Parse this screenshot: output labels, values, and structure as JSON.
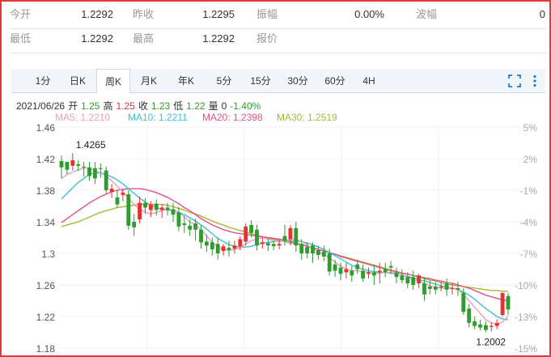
{
  "quote": {
    "rows": [
      [
        {
          "label": "今开",
          "value": "1.2292"
        },
        {
          "label": "昨收",
          "value": "1.2295"
        },
        {
          "label": "振幅",
          "value": "0.00%"
        },
        {
          "label": "波幅",
          "value": "0"
        }
      ],
      [
        {
          "label": "最低",
          "value": "1.2292"
        },
        {
          "label": "最高",
          "value": "1.2292"
        },
        {
          "label": "报价",
          "value": ""
        },
        {
          "label": "",
          "value": ""
        }
      ]
    ]
  },
  "tabs": [
    "1分",
    "日K",
    "周K",
    "月K",
    "年K",
    "5分",
    "15分",
    "30分",
    "60分",
    "4H"
  ],
  "active_tab": "周K",
  "toolbar_icons": [
    "fullscreen-icon",
    "more-vertical-icon"
  ],
  "info": {
    "date": "2021/06/26",
    "open_label": "开",
    "open": "1.25",
    "high_label": "高",
    "high": "1.25",
    "close_label": "收",
    "close": "1.23",
    "low_label": "低",
    "low": "1.22",
    "vol_label": "量",
    "vol": "0",
    "change": "-1.40%"
  },
  "ma_legend": [
    {
      "text": "MA5: 1.2210",
      "color": "#e8a0c0"
    },
    {
      "text": "MA10: 1.2211",
      "color": "#3cc0d0"
    },
    {
      "text": "MA20: 1.2398",
      "color": "#e0508c"
    },
    {
      "text": "MA30: 1.2519",
      "color": "#a8b830"
    }
  ],
  "colors": {
    "up": "#e8312f",
    "down": "#2e9c2e",
    "border": "#e03a3a"
  },
  "chart_data": {
    "type": "candlestick",
    "ylim": [
      1.18,
      1.46
    ],
    "y_ticks": [
      "1.46",
      "1.42",
      "1.38",
      "1.34",
      "1.3",
      "1.26",
      "1.22",
      "1.18"
    ],
    "pct_ticks": [
      "5%",
      "2%",
      "-1%",
      "-4%",
      "-7%",
      "-10%",
      "-13%",
      "-15%"
    ],
    "max_label": "1.4265",
    "min_label": "1.2002",
    "candles": [
      [
        1.417,
        1.424,
        1.409,
        1.395,
        "d"
      ],
      [
        1.406,
        1.413,
        1.416,
        1.4,
        "d"
      ],
      [
        1.411,
        1.427,
        1.418,
        1.405,
        "u"
      ],
      [
        1.413,
        1.418,
        1.411,
        1.404,
        "d"
      ],
      [
        1.409,
        1.416,
        1.41,
        1.397,
        "d"
      ],
      [
        1.409,
        1.416,
        1.398,
        1.392,
        "d"
      ],
      [
        1.408,
        1.416,
        1.395,
        1.388,
        "d"
      ],
      [
        1.408,
        1.414,
        1.407,
        1.396,
        "d"
      ],
      [
        1.405,
        1.41,
        1.38,
        1.375,
        "d"
      ],
      [
        1.378,
        1.388,
        1.382,
        1.37,
        "u"
      ],
      [
        1.371,
        1.38,
        1.362,
        1.358,
        "d"
      ],
      [
        1.374,
        1.382,
        1.377,
        1.366,
        "u"
      ],
      [
        1.375,
        1.38,
        1.335,
        1.33,
        "d"
      ],
      [
        1.34,
        1.35,
        1.333,
        1.322,
        "d"
      ],
      [
        1.343,
        1.372,
        1.364,
        1.338,
        "u"
      ],
      [
        1.364,
        1.37,
        1.358,
        1.35,
        "d"
      ],
      [
        1.355,
        1.366,
        1.362,
        1.346,
        "u"
      ],
      [
        1.363,
        1.368,
        1.355,
        1.348,
        "d"
      ],
      [
        1.355,
        1.362,
        1.358,
        1.345,
        "u"
      ],
      [
        1.358,
        1.364,
        1.355,
        1.348,
        "d"
      ],
      [
        1.356,
        1.364,
        1.349,
        1.34,
        "d"
      ],
      [
        1.352,
        1.359,
        1.334,
        1.328,
        "d"
      ],
      [
        1.338,
        1.348,
        1.336,
        1.326,
        "d"
      ],
      [
        1.335,
        1.343,
        1.33,
        1.322,
        "d"
      ],
      [
        1.338,
        1.344,
        1.33,
        1.316,
        "d"
      ],
      [
        1.33,
        1.336,
        1.314,
        1.306,
        "d"
      ],
      [
        1.315,
        1.324,
        1.31,
        1.302,
        "d"
      ],
      [
        1.314,
        1.32,
        1.305,
        1.297,
        "d"
      ],
      [
        1.312,
        1.32,
        1.3,
        1.292,
        "d"
      ],
      [
        1.303,
        1.312,
        1.309,
        1.297,
        "u"
      ],
      [
        1.307,
        1.316,
        1.304,
        1.296,
        "d"
      ],
      [
        1.306,
        1.316,
        1.31,
        1.3,
        "u"
      ],
      [
        1.309,
        1.322,
        1.318,
        1.304,
        "u"
      ],
      [
        1.315,
        1.338,
        1.334,
        1.31,
        "u"
      ],
      [
        1.336,
        1.342,
        1.326,
        1.32,
        "d"
      ],
      [
        1.33,
        1.336,
        1.31,
        1.304,
        "d"
      ],
      [
        1.312,
        1.32,
        1.314,
        1.306,
        "u"
      ],
      [
        1.313,
        1.318,
        1.31,
        1.303,
        "d"
      ],
      [
        1.312,
        1.316,
        1.309,
        1.304,
        "d"
      ],
      [
        1.31,
        1.318,
        1.312,
        1.305,
        "u"
      ],
      [
        1.322,
        1.336,
        1.316,
        1.31,
        "d"
      ],
      [
        1.318,
        1.336,
        1.332,
        1.31,
        "u"
      ],
      [
        1.332,
        1.34,
        1.31,
        1.302,
        "d"
      ],
      [
        1.312,
        1.318,
        1.3,
        1.292,
        "d"
      ],
      [
        1.308,
        1.314,
        1.3,
        1.294,
        "d"
      ],
      [
        1.31,
        1.314,
        1.3,
        1.288,
        "d"
      ],
      [
        1.304,
        1.31,
        1.298,
        1.292,
        "d"
      ],
      [
        1.302,
        1.31,
        1.296,
        1.29,
        "d"
      ],
      [
        1.3,
        1.306,
        1.277,
        1.272,
        "d"
      ],
      [
        1.286,
        1.292,
        1.278,
        1.27,
        "d"
      ],
      [
        1.282,
        1.288,
        1.274,
        1.266,
        "d"
      ],
      [
        1.28,
        1.288,
        1.276,
        1.268,
        "u"
      ],
      [
        1.278,
        1.284,
        1.272,
        1.264,
        "d"
      ],
      [
        1.286,
        1.292,
        1.28,
        1.274,
        "d"
      ],
      [
        1.278,
        1.286,
        1.268,
        1.264,
        "d"
      ],
      [
        1.274,
        1.282,
        1.276,
        1.268,
        "u"
      ],
      [
        1.276,
        1.286,
        1.272,
        1.26,
        "d"
      ],
      [
        1.278,
        1.288,
        1.276,
        1.262,
        "u"
      ],
      [
        1.28,
        1.288,
        1.276,
        1.27,
        "d"
      ],
      [
        1.284,
        1.29,
        1.282,
        1.274,
        "d"
      ],
      [
        1.276,
        1.282,
        1.27,
        1.262,
        "d"
      ],
      [
        1.272,
        1.28,
        1.266,
        1.262,
        "d"
      ],
      [
        1.27,
        1.276,
        1.262,
        1.256,
        "d"
      ],
      [
        1.27,
        1.278,
        1.26,
        1.254,
        "d"
      ],
      [
        1.262,
        1.274,
        1.272,
        1.256,
        "u"
      ],
      [
        1.262,
        1.27,
        1.248,
        1.24,
        "d"
      ],
      [
        1.258,
        1.266,
        1.255,
        1.248,
        "d"
      ],
      [
        1.258,
        1.264,
        1.254,
        1.248,
        "d"
      ],
      [
        1.258,
        1.264,
        1.258,
        1.252,
        "u"
      ],
      [
        1.262,
        1.268,
        1.254,
        1.246,
        "d"
      ],
      [
        1.256,
        1.262,
        1.256,
        1.248,
        "u"
      ],
      [
        1.256,
        1.264,
        1.254,
        1.246,
        "d"
      ],
      [
        1.25,
        1.256,
        1.226,
        1.222,
        "d"
      ],
      [
        1.23,
        1.236,
        1.212,
        1.206,
        "d"
      ],
      [
        1.214,
        1.22,
        1.208,
        1.204,
        "d"
      ],
      [
        1.21,
        1.216,
        1.206,
        1.202,
        "d"
      ],
      [
        1.209,
        1.214,
        1.203,
        1.2,
        "d"
      ],
      [
        1.207,
        1.212,
        1.208,
        1.201,
        "u"
      ],
      [
        1.208,
        1.216,
        1.212,
        1.204,
        "u"
      ],
      [
        1.222,
        1.25,
        1.25,
        1.22,
        "u"
      ],
      [
        1.246,
        1.25,
        1.229,
        1.222,
        "d"
      ]
    ],
    "ma5": [
      1.395,
      1.4,
      1.403,
      1.406,
      1.408,
      1.408,
      1.405,
      1.402,
      1.398,
      1.392,
      1.385,
      1.377,
      1.37,
      1.362,
      1.356,
      1.352,
      1.35,
      1.352,
      1.354,
      1.356,
      1.355,
      1.352,
      1.346,
      1.34,
      1.336,
      1.33,
      1.322,
      1.314,
      1.308,
      1.305,
      1.304,
      1.305,
      1.307,
      1.312,
      1.316,
      1.318,
      1.32,
      1.318,
      1.316,
      1.315,
      1.316,
      1.318,
      1.318,
      1.315,
      1.311,
      1.306,
      1.302,
      1.299,
      1.294,
      1.289,
      1.284,
      1.28,
      1.278,
      1.278,
      1.277,
      1.276,
      1.275,
      1.275,
      1.276,
      1.276,
      1.275,
      1.273,
      1.27,
      1.267,
      1.265,
      1.262,
      1.259,
      1.257,
      1.256,
      1.256,
      1.256,
      1.254,
      1.248,
      1.24,
      1.232,
      1.224,
      1.216,
      1.212,
      1.21,
      1.213,
      1.221
    ],
    "ma10": [
      1.369,
      1.376,
      1.383,
      1.39,
      1.395,
      1.4,
      1.402,
      1.402,
      1.4,
      1.397,
      1.393,
      1.388,
      1.382,
      1.376,
      1.37,
      1.365,
      1.361,
      1.358,
      1.356,
      1.355,
      1.354,
      1.352,
      1.349,
      1.345,
      1.341,
      1.336,
      1.331,
      1.325,
      1.319,
      1.315,
      1.311,
      1.309,
      1.308,
      1.308,
      1.309,
      1.311,
      1.313,
      1.314,
      1.315,
      1.316,
      1.316,
      1.316,
      1.316,
      1.315,
      1.313,
      1.311,
      1.308,
      1.305,
      1.301,
      1.297,
      1.293,
      1.289,
      1.285,
      1.282,
      1.28,
      1.278,
      1.277,
      1.276,
      1.276,
      1.275,
      1.274,
      1.273,
      1.271,
      1.269,
      1.267,
      1.265,
      1.263,
      1.261,
      1.259,
      1.257,
      1.256,
      1.254,
      1.251,
      1.247,
      1.242,
      1.236,
      1.23,
      1.225,
      1.22,
      1.217,
      1.216
    ],
    "ma20": [
      1.339,
      1.344,
      1.349,
      1.354,
      1.359,
      1.364,
      1.368,
      1.372,
      1.375,
      1.378,
      1.38,
      1.381,
      1.382,
      1.382,
      1.382,
      1.381,
      1.379,
      1.377,
      1.374,
      1.371,
      1.367,
      1.363,
      1.358,
      1.354,
      1.349,
      1.344,
      1.34,
      1.336,
      1.333,
      1.33,
      1.328,
      1.326,
      1.325,
      1.324,
      1.323,
      1.322,
      1.321,
      1.32,
      1.319,
      1.318,
      1.317,
      1.315,
      1.313,
      1.311,
      1.309,
      1.307,
      1.305,
      1.303,
      1.301,
      1.299,
      1.296,
      1.294,
      1.292,
      1.29,
      1.288,
      1.286,
      1.284,
      1.282,
      1.28,
      1.278,
      1.277,
      1.275,
      1.274,
      1.272,
      1.271,
      1.269,
      1.268,
      1.266,
      1.265,
      1.263,
      1.262,
      1.26,
      1.258,
      1.256,
      1.253,
      1.25,
      1.247,
      1.245,
      1.243,
      1.241,
      1.24
    ],
    "ma30": [
      1.334,
      1.336,
      1.338,
      1.34,
      1.343,
      1.346,
      1.349,
      1.352,
      1.354,
      1.356,
      1.358,
      1.359,
      1.36,
      1.361,
      1.362,
      1.362,
      1.362,
      1.362,
      1.362,
      1.361,
      1.359,
      1.357,
      1.355,
      1.352,
      1.35,
      1.347,
      1.344,
      1.341,
      1.338,
      1.336,
      1.333,
      1.331,
      1.329,
      1.327,
      1.325,
      1.323,
      1.321,
      1.319,
      1.318,
      1.316,
      1.315,
      1.313,
      1.312,
      1.311,
      1.309,
      1.307,
      1.305,
      1.303,
      1.301,
      1.299,
      1.297,
      1.295,
      1.293,
      1.291,
      1.289,
      1.287,
      1.285,
      1.283,
      1.281,
      1.279,
      1.277,
      1.275,
      1.274,
      1.272,
      1.27,
      1.268,
      1.266,
      1.265,
      1.263,
      1.261,
      1.26,
      1.259,
      1.258,
      1.257,
      1.256,
      1.255,
      1.254,
      1.253,
      1.253,
      1.252,
      1.252
    ]
  }
}
